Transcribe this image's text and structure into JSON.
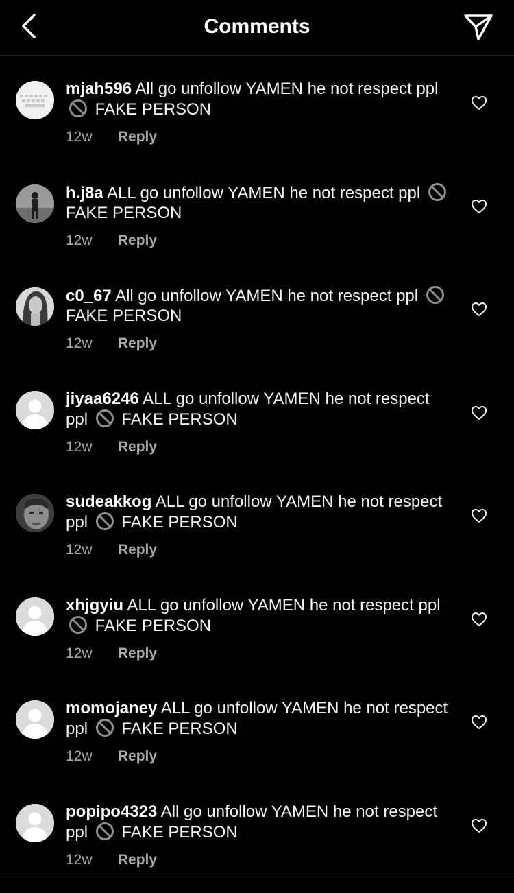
{
  "header": {
    "title": "Comments"
  },
  "comments": [
    {
      "username": "mjah596",
      "text_start": "All go unfollow YAMEN he not respect ppl",
      "text_end": "FAKE PERSON",
      "time": "12w",
      "reply": "Reply",
      "avatar": "keyboard"
    },
    {
      "username": "h.j8a",
      "text_start": "ALL go unfollow YAMEN he not respect ppl",
      "text_end": "FAKE PERSON",
      "time": "12w",
      "reply": "Reply",
      "avatar": "person-photo"
    },
    {
      "username": "c0_67",
      "text_start": "All go unfollow YAMEN he not respect ppl",
      "text_end": "FAKE PERSON",
      "time": "12w",
      "reply": "Reply",
      "avatar": "portrait-photo"
    },
    {
      "username": "jiyaa6246",
      "text_start": "ALL go unfollow YAMEN he not respect ppl",
      "text_end": "FAKE PERSON",
      "time": "12w",
      "reply": "Reply",
      "avatar": "default"
    },
    {
      "username": "sudeakkog",
      "text_start": "ALL go unfollow YAMEN he not respect ppl",
      "text_end": "FAKE PERSON",
      "time": "12w",
      "reply": "Reply",
      "avatar": "face-photo"
    },
    {
      "username": "xhjgyiu",
      "text_start": "ALL go unfollow YAMEN he not respect ppl",
      "text_end": "FAKE PERSON",
      "time": "12w",
      "reply": "Reply",
      "avatar": "default"
    },
    {
      "username": "momojaney",
      "text_start": "ALL go unfollow YAMEN he not respect ppl",
      "text_end": "FAKE PERSON",
      "time": "12w",
      "reply": "Reply",
      "avatar": "default"
    },
    {
      "username": "popipo4323",
      "text_start": "All go unfollow YAMEN he not respect ppl",
      "text_end": "FAKE PERSON",
      "time": "12w",
      "reply": "Reply",
      "avatar": "default"
    }
  ],
  "icons": {
    "back": "chevron-left-icon",
    "share": "paper-plane-icon",
    "like": "heart-icon",
    "prohibited": "no-entry-icon"
  }
}
